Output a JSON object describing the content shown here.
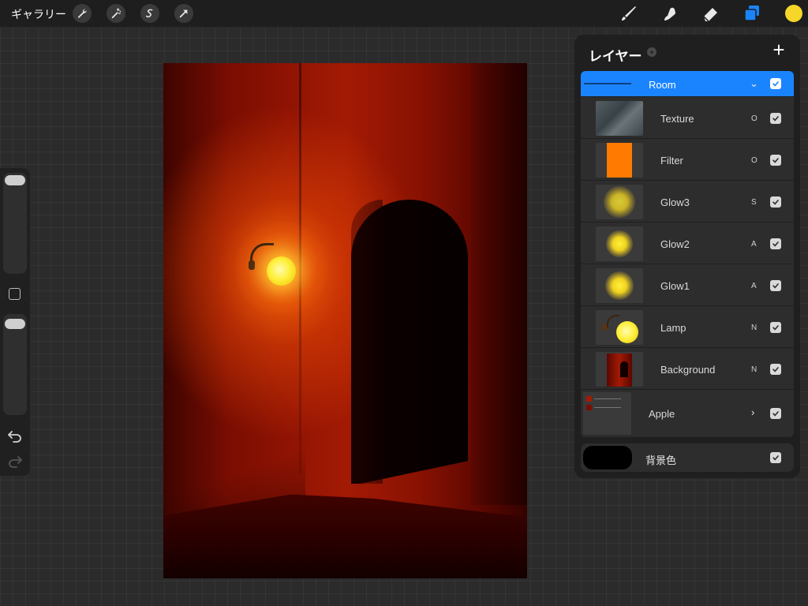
{
  "topbar": {
    "gallery_label": "ギャラリー",
    "left_tools": [
      "wrench-icon",
      "magic-wand-icon",
      "selection-icon",
      "transform-arrow-icon"
    ],
    "right_tools": [
      "brush-icon",
      "smudge-icon",
      "eraser-icon",
      "layers-icon"
    ],
    "current_color": "#f7d62a"
  },
  "sidebar": {
    "brush_size_level": 0.95,
    "opacity_level": 0.95
  },
  "layers_panel": {
    "title": "レイヤー",
    "group": {
      "name": "Room",
      "expanded": true,
      "visible": true
    },
    "layers": [
      {
        "name": "Texture",
        "blend_mode": "O",
        "visible": true
      },
      {
        "name": "Filter",
        "blend_mode": "O",
        "visible": true
      },
      {
        "name": "Glow3",
        "blend_mode": "S",
        "visible": true
      },
      {
        "name": "Glow2",
        "blend_mode": "A",
        "visible": true
      },
      {
        "name": "Glow1",
        "blend_mode": "A",
        "visible": true
      },
      {
        "name": "Lamp",
        "blend_mode": "N",
        "visible": true
      },
      {
        "name": "Background",
        "blend_mode": "N",
        "visible": true
      }
    ],
    "collapsed_group": {
      "name": "Apple",
      "visible": true
    },
    "background_color": {
      "label": "背景色",
      "color": "#000000",
      "visible": true
    }
  },
  "colors": {
    "accent": "#1a84ff",
    "panel_bg": "#1f1f1f",
    "row_bg": "#2d2d2d"
  }
}
